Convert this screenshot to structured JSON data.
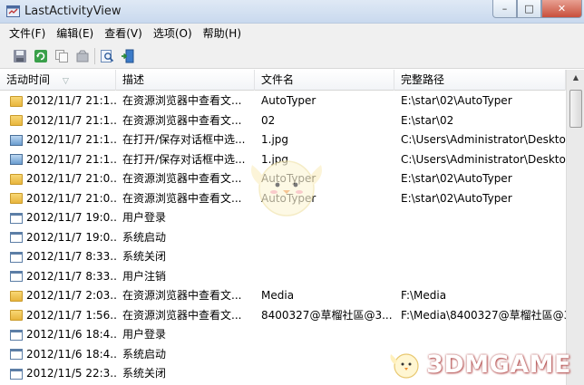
{
  "window": {
    "title": "LastActivityView",
    "buttons": {
      "minimize": "–",
      "maximize": "□",
      "close": "✕"
    }
  },
  "menu": [
    "文件(F)",
    "编辑(E)",
    "查看(V)",
    "选项(O)",
    "帮助(H)"
  ],
  "toolbar": {
    "icons": [
      "save-icon",
      "refresh-icon",
      "copy-icon",
      "properties-icon",
      "find-icon",
      "exit-icon"
    ]
  },
  "columns": [
    "活动时间",
    "描述",
    "文件名",
    "完整路径"
  ],
  "sort_indicator": "▽",
  "rows": [
    {
      "icon": "folder",
      "time": "2012/11/7 21:1...",
      "desc": "在资源浏览器中查看文...",
      "file": "AutoTyper",
      "path": "E:\\star\\02\\AutoTyper"
    },
    {
      "icon": "folder",
      "time": "2012/11/7 21:1...",
      "desc": "在资源浏览器中查看文...",
      "file": "02",
      "path": "E:\\star\\02"
    },
    {
      "icon": "image",
      "time": "2012/11/7 21:1...",
      "desc": "在打开/保存对话框中选...",
      "file": "1.jpg",
      "path": "C:\\Users\\Administrator\\Deskto"
    },
    {
      "icon": "image",
      "time": "2012/11/7 21:1...",
      "desc": "在打开/保存对话框中选...",
      "file": "1.jpg",
      "path": "C:\\Users\\Administrator\\Deskto"
    },
    {
      "icon": "folder",
      "time": "2012/11/7 21:0...",
      "desc": "在资源浏览器中查看文...",
      "file": "AutoTyper",
      "path": "E:\\star\\02\\AutoTyper"
    },
    {
      "icon": "folder",
      "time": "2012/11/7 21:0...",
      "desc": "在资源浏览器中查看文...",
      "file": "AutoTyper",
      "path": "E:\\star\\02\\AutoTyper"
    },
    {
      "icon": "window",
      "time": "2012/11/7 19:0...",
      "desc": "用户登录",
      "file": "",
      "path": ""
    },
    {
      "icon": "window",
      "time": "2012/11/7 19:0...",
      "desc": "系统启动",
      "file": "",
      "path": ""
    },
    {
      "icon": "window",
      "time": "2012/11/7 8:33...",
      "desc": "系统关闭",
      "file": "",
      "path": ""
    },
    {
      "icon": "window",
      "time": "2012/11/7 8:33...",
      "desc": "用户注销",
      "file": "",
      "path": ""
    },
    {
      "icon": "folder",
      "time": "2012/11/7 2:03...",
      "desc": "在资源浏览器中查看文...",
      "file": "Media",
      "path": "F:\\Media"
    },
    {
      "icon": "folder",
      "time": "2012/11/7 1:56...",
      "desc": "在资源浏览器中查看文...",
      "file": "8400327@草榴社區@3...",
      "path": "F:\\Media\\8400327@草榴社區@3"
    },
    {
      "icon": "window",
      "time": "2012/11/6 18:4...",
      "desc": "用户登录",
      "file": "",
      "path": ""
    },
    {
      "icon": "window",
      "time": "2012/11/6 18:4...",
      "desc": "系统启动",
      "file": "",
      "path": ""
    },
    {
      "icon": "window",
      "time": "2012/11/5 22:3...",
      "desc": "系统关闭",
      "file": "",
      "path": ""
    }
  ],
  "watermark": {
    "text": "3DMGAME"
  }
}
